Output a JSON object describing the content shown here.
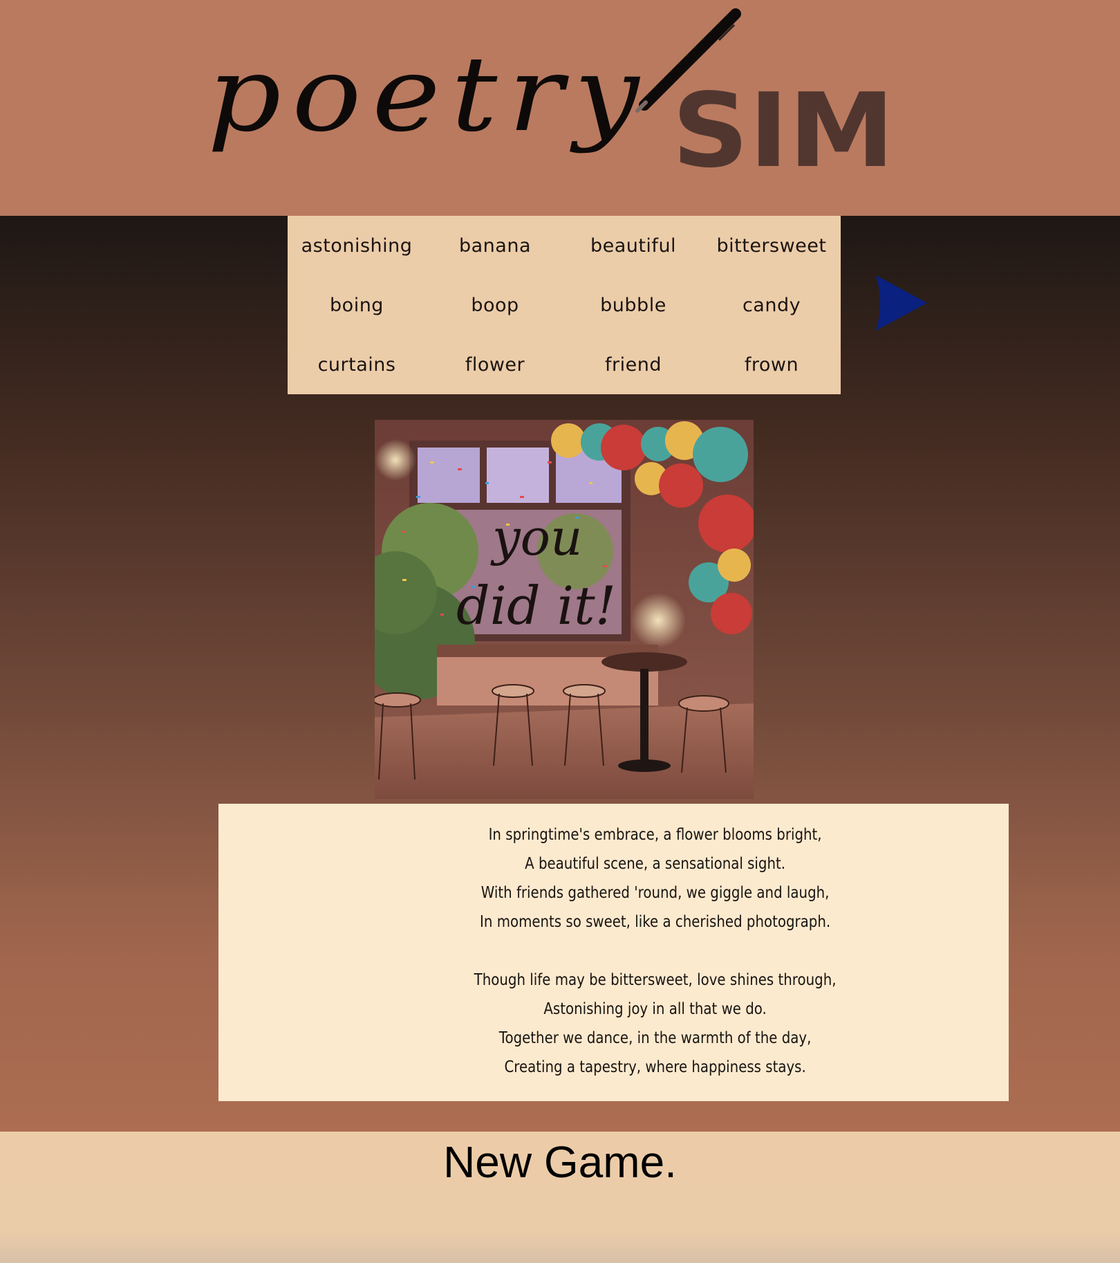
{
  "header": {
    "logo_script": "poetry",
    "logo_sim": "SIM"
  },
  "words": [
    "astonishing",
    "banana",
    "beautiful",
    "bittersweet",
    "boing",
    "boop",
    "bubble",
    "candy",
    "curtains",
    "flower",
    "friend",
    "frown"
  ],
  "next_arrow": {
    "icon": "play-triangle-icon",
    "color": "#0a2180"
  },
  "scene": {
    "overlay_line1": "you",
    "overlay_line2": "did it!"
  },
  "poem": {
    "stanza1": [
      "In springtime's embrace, a flower blooms bright,",
      "A beautiful scene, a sensational sight.",
      "With friends gathered 'round, we giggle and laugh,",
      "In moments so sweet, like a cherished photograph."
    ],
    "stanza2": [
      "Though life may be bittersweet, love shines through,",
      "Astonishing joy in all that we do.",
      "Together we dance, in the warmth of the day,",
      "Creating a tapestry, where happiness stays."
    ]
  },
  "footer": {
    "new_game_label": "New Game."
  },
  "colors": {
    "header_bg": "#ba7a5f",
    "tile_bg": "#eccda9",
    "poem_bg": "#fceacf",
    "sim_text": "#513630"
  }
}
